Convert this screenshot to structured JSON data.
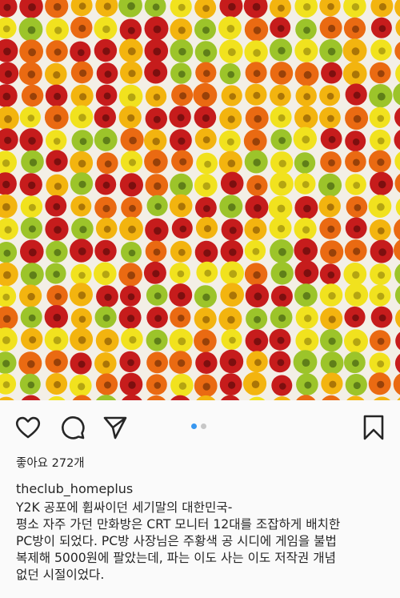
{
  "post": {
    "image_description": "colorful ring cereal loops arranged in a grid",
    "image_colors": [
      "#c61c1c",
      "#ea6a12",
      "#f3b40f",
      "#f1e21e",
      "#9cc42a"
    ]
  },
  "actions": {
    "like_icon": "heart-icon",
    "comment_icon": "comment-icon",
    "share_icon": "send-icon",
    "save_icon": "bookmark-icon",
    "carousel_active_index": 1,
    "carousel_total": 2,
    "dot_active_color": "#3897f0",
    "dot_inactive_color": "#c7c7c7"
  },
  "likes": {
    "text": "좋아요 272개"
  },
  "caption": {
    "username": "theclub_homeplus",
    "lines": [
      "Y2K 공포에 휩싸이던 세기말의 대한민국-",
      "평소 자주 가던 만화방은 CRT 모니터 12대를 조잡하게 배치한",
      "PC방이 되었다. PC방 사장님은 주황색 공 시디에 게임을 불법",
      "복제해 5000원에 팔았는데, 파는 이도 사는 이도 저작권 개념",
      "없던 시절이었다."
    ]
  }
}
